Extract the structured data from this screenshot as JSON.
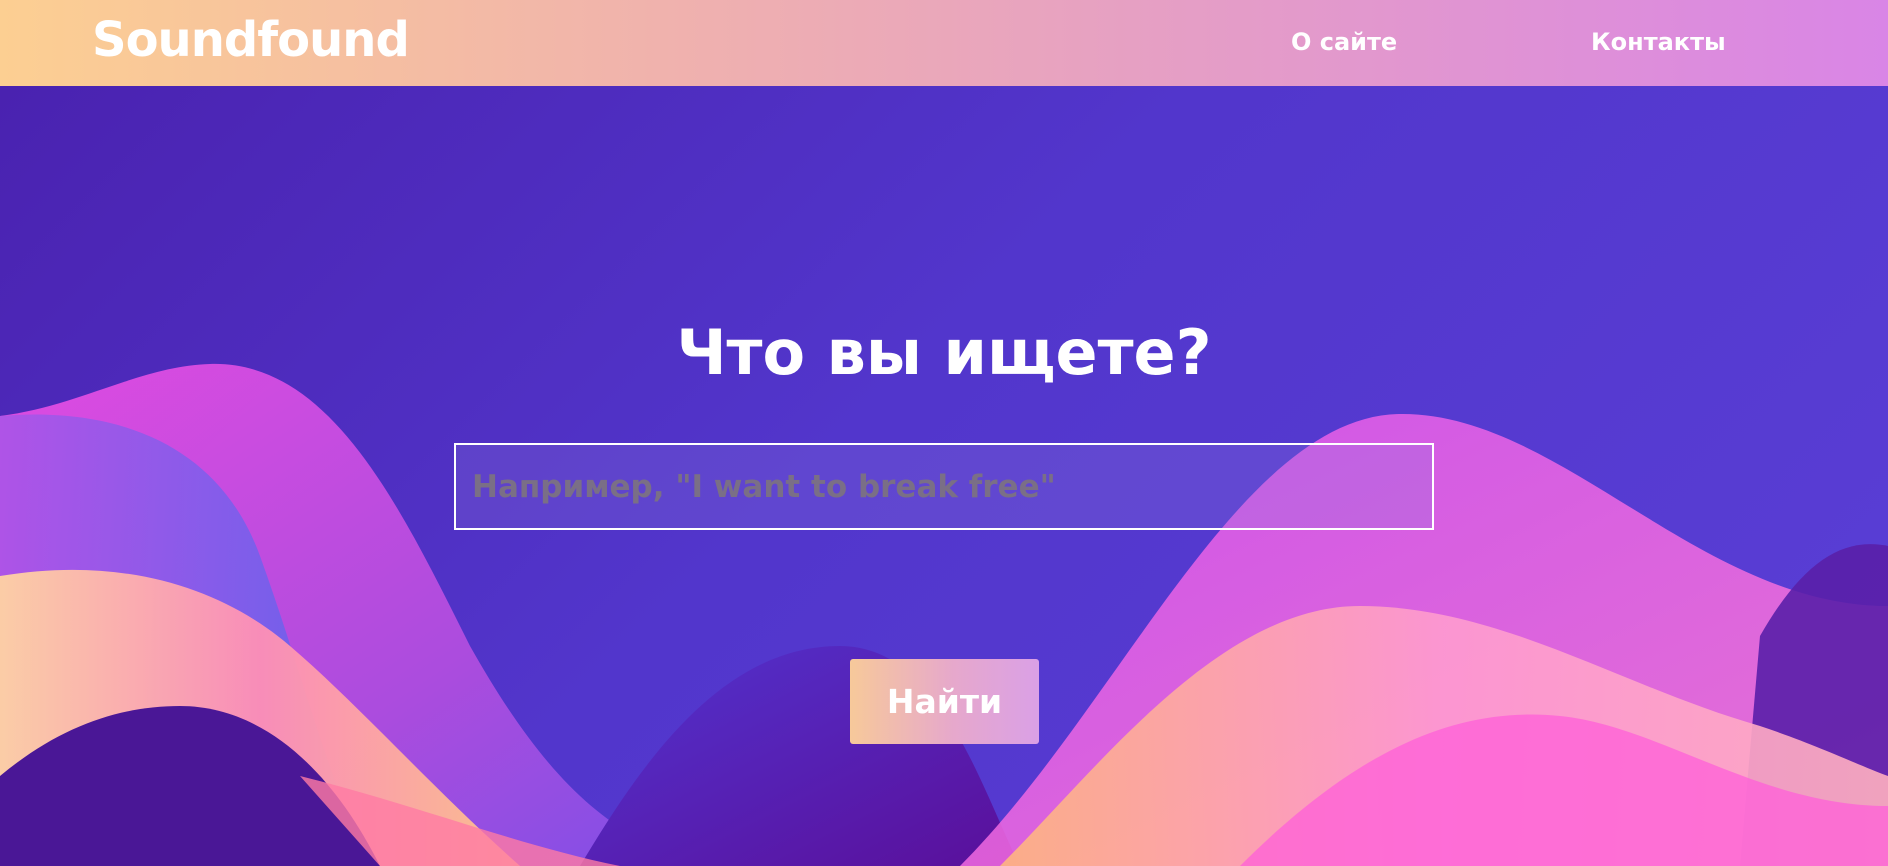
{
  "header": {
    "brand": "Soundfound",
    "nav": {
      "about": "О сайте",
      "contacts": "Контакты"
    }
  },
  "main": {
    "headline": "Что вы ищете?",
    "search": {
      "value": "",
      "placeholder": "Например, \"I want to break free\""
    },
    "submit_label": "Найти"
  },
  "colors": {
    "background": "#5236cc",
    "header_gradient_start": "#fccf92",
    "header_gradient_end": "#d985e6",
    "wave_pink": "#f252e0",
    "wave_peach": "#ffc58a",
    "text": "#ffffff"
  }
}
